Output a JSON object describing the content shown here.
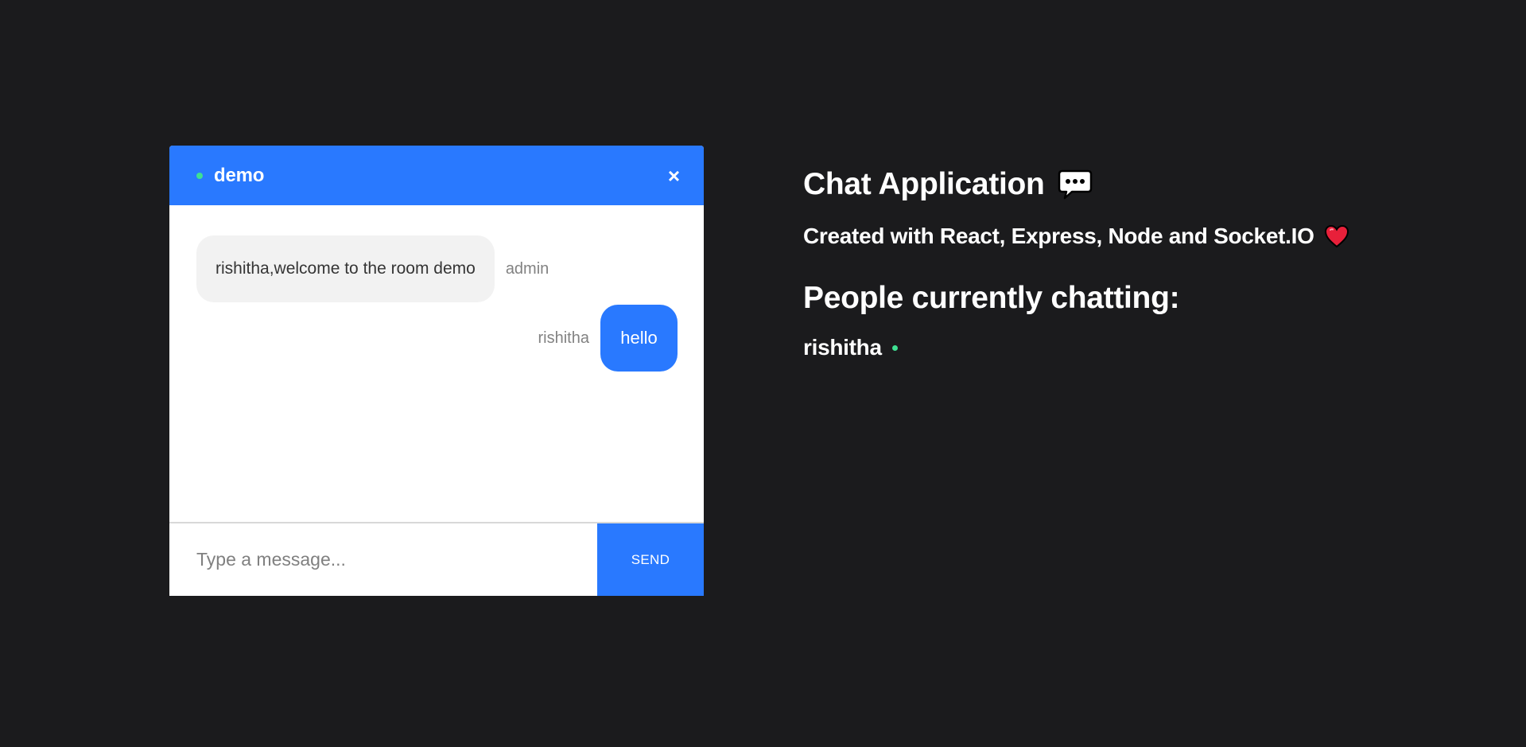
{
  "chat": {
    "room_name": "demo",
    "close_label": "×",
    "messages": [
      {
        "text": "rishitha,welcome to the room demo",
        "sender": "admin",
        "side": "left"
      },
      {
        "text": "hello",
        "sender": "rishitha",
        "side": "right"
      }
    ],
    "input_placeholder": "Type a message...",
    "send_label": "SEND"
  },
  "info": {
    "title": "Chat Application",
    "subtitle": "Created with React, Express, Node and Socket.IO",
    "people_title": "People currently chatting:",
    "people": [
      "rishitha"
    ]
  },
  "icons": {
    "title_icon": "speech-bubble-icon",
    "subtitle_icon": "heart-icon",
    "status_icon": "online-dot-icon"
  },
  "colors": {
    "background": "#1b1b1d",
    "accent": "#2979ff",
    "online": "#3ee092",
    "bubble_light": "#f2f2f2"
  }
}
